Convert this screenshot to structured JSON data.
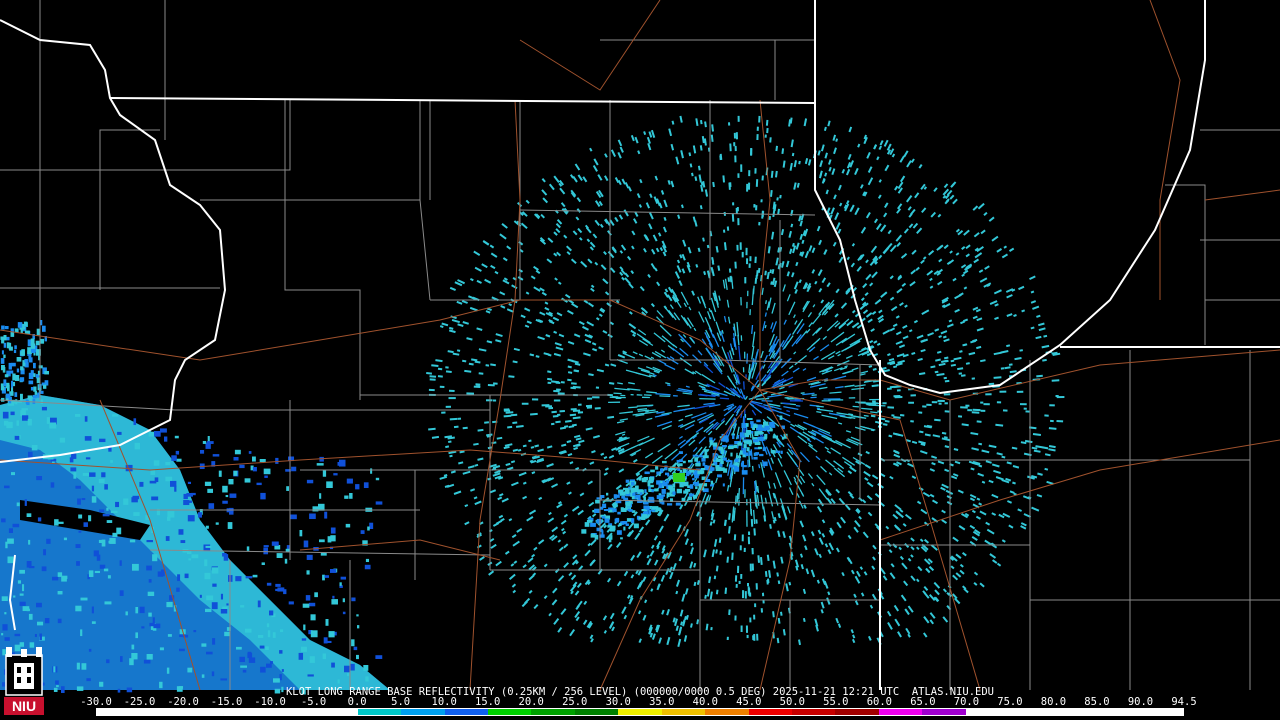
{
  "product": {
    "caption": "KLOT LONG RANGE BASE REFLECTIVITY (0.25KM / 256 LEVEL) (000000/0000 0.5 DEG) 2025-11-21 12:21 UTC  ATLAS.NIU.EDU"
  },
  "logo": {
    "text": "NIU",
    "color": "#c8102e"
  },
  "legend": {
    "ticks": [
      "-30.0",
      "-25.0",
      "-20.0",
      "-15.0",
      "-10.0",
      "-5.0",
      "0.0",
      "5.0",
      "10.0",
      "15.0",
      "20.0",
      "25.0",
      "30.0",
      "35.0",
      "40.0",
      "45.0",
      "50.0",
      "55.0",
      "60.0",
      "65.0",
      "70.0",
      "75.0",
      "80.0",
      "85.0",
      "90.0",
      "94.5"
    ],
    "colors": [
      "#ffffff",
      "#ffffff",
      "#ffffff",
      "#ffffff",
      "#ffffff",
      "#ffffff",
      "#00c8c8",
      "#00a0f0",
      "#1060f0",
      "#00d000",
      "#00a000",
      "#008000",
      "#f0f000",
      "#f0c000",
      "#f08000",
      "#f00000",
      "#c80000",
      "#a00000",
      "#f000f0",
      "#a000d0",
      "#ffffff",
      "#ffffff",
      "#ffffff",
      "#ffffff",
      "#ffffff"
    ]
  },
  "colors": {
    "background": "#000000",
    "state_border": "#ffffff",
    "county_border": "#8a8a8a",
    "highway": "#a0522d",
    "echo_light": "#33c8d8",
    "echo_mid": "#1a8cf0",
    "echo_heavy": "#1050d8",
    "echo_green": "#30d020"
  }
}
